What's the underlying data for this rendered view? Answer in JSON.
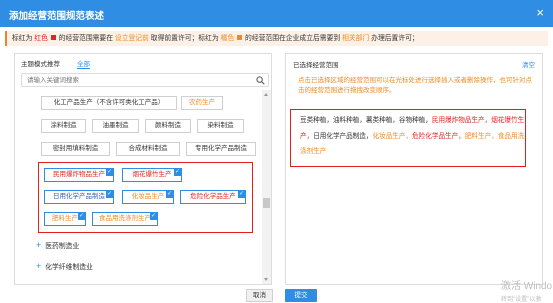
{
  "dialog": {
    "title": "添加经营范围规范表述",
    "close_glyph": "×"
  },
  "notice": {
    "p1": "标红为",
    "red_word": "红色",
    "p2": "的经营范围需要在",
    "red_link": "设立登记前",
    "p3": "取得前置许可；标红为",
    "org_word": "橘色",
    "p4": "的经营范围在企业成立后需要到",
    "org_link": "相关部门",
    "p5": "办理后置许可；"
  },
  "left_panel": {
    "tab_main": "主题模式推荐",
    "tab_all": "全部",
    "search_placeholder": "请输入关键词搜索",
    "chips": [
      {
        "label": "化工产品生产（不含许可类化工产品）",
        "color": "normal",
        "selected": false
      },
      {
        "label": "农药生产",
        "color": "orange",
        "selected": false
      },
      {
        "label": "涂料制造",
        "color": "normal",
        "selected": false
      },
      {
        "label": "油墨制造",
        "color": "normal",
        "selected": false
      },
      {
        "label": "颜料制造",
        "color": "normal",
        "selected": false
      },
      {
        "label": "染料制造",
        "color": "normal",
        "selected": false
      },
      {
        "label": "密封用填料制造",
        "color": "normal",
        "selected": false
      },
      {
        "label": "合成材料制造",
        "color": "normal",
        "selected": false
      },
      {
        "label": "专用化学产品制造",
        "color": "normal",
        "selected": false
      },
      {
        "label": "民用爆炸物品生产",
        "color": "red",
        "selected": true
      },
      {
        "label": "烟花爆竹生产",
        "color": "red",
        "selected": true
      },
      {
        "label": "日用化学产品制造",
        "color": "blue",
        "selected": true
      },
      {
        "label": "化妆品生产",
        "color": "orange",
        "selected": true
      },
      {
        "label": "危险化学品生产",
        "color": "red",
        "selected": true
      },
      {
        "label": "肥料生产",
        "color": "orange",
        "selected": true
      },
      {
        "label": "食品用洗涤剂生产",
        "color": "orange",
        "selected": true
      }
    ],
    "categories": [
      {
        "plus": "+",
        "label": "医药制造业"
      },
      {
        "plus": "+",
        "label": "化学纤维制造业"
      }
    ]
  },
  "right_panel": {
    "title": "已选择经营范围",
    "clear": "清空",
    "hint": "点击已选择区域的经营范围可以在光标处进行选择插入或者删除操作，也可针对点击的经营范围进行拖拽改变顺序。",
    "items": [
      {
        "text": "豆类种植，油料种植，薯类种植，谷物种植，",
        "color": "normal"
      },
      {
        "text": "民用爆炸物品生产，",
        "color": "red"
      },
      {
        "text": "烟花爆竹生产，",
        "color": "red"
      },
      {
        "text": "日用化学产品制造，",
        "color": "normal"
      },
      {
        "text": "化妆品生产，",
        "color": "orange"
      },
      {
        "text": "危险化学品生产，",
        "color": "red"
      },
      {
        "text": "肥料生产，",
        "color": "orange"
      },
      {
        "text": "食品用洗涤剂生产",
        "color": "orange"
      }
    ]
  },
  "buttons": {
    "cancel": "取消",
    "ok": "提交"
  },
  "watermark": {
    "line1": "激活 Windo",
    "line2": "转到\"设置\"以激"
  },
  "colors": {
    "accent": "#2f8de4",
    "red": "#e02424",
    "orange": "#f08a24",
    "annotation": "#e0201c"
  }
}
